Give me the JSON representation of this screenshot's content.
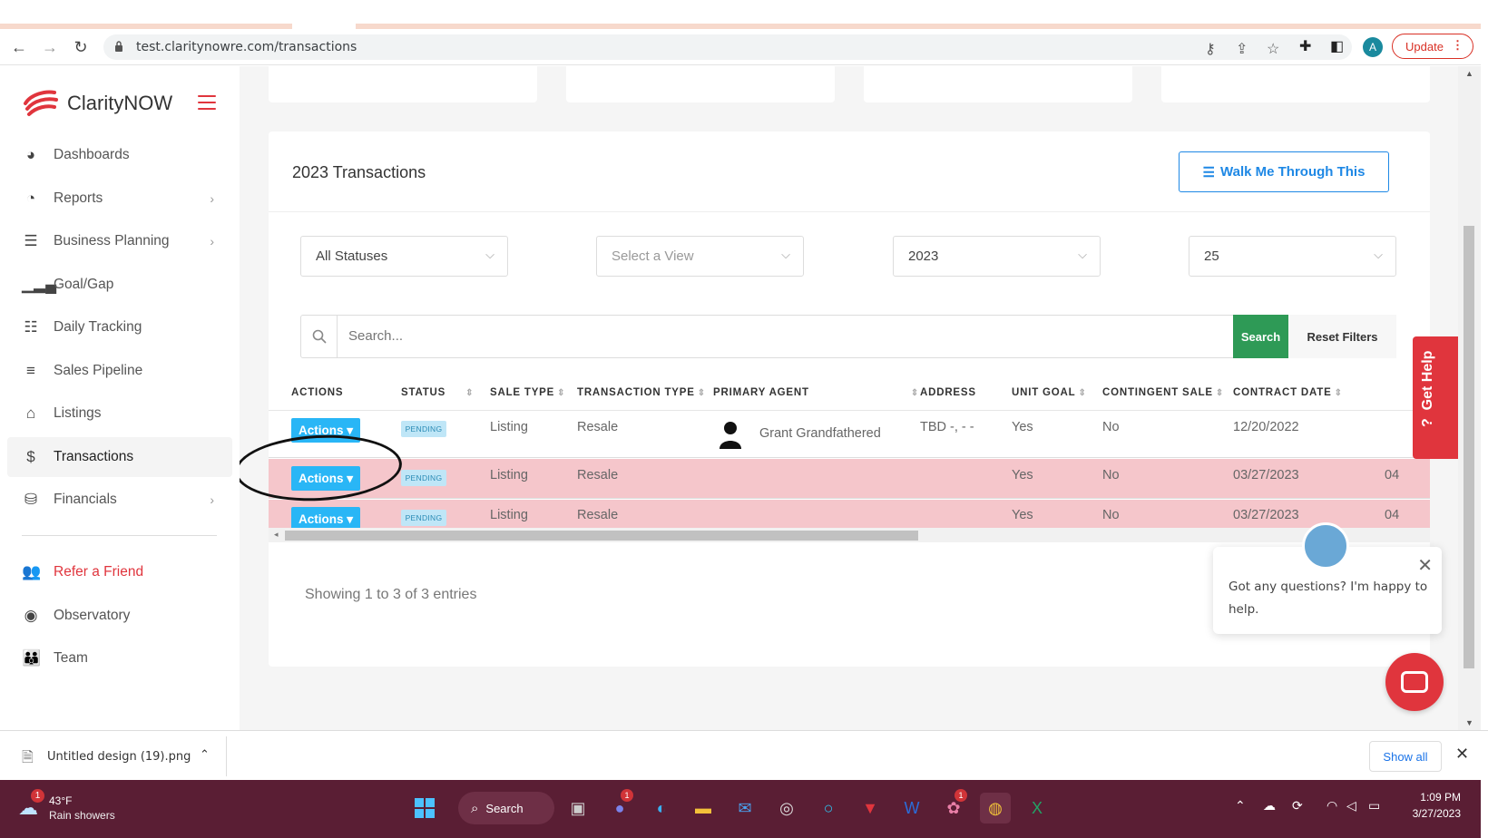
{
  "browser": {
    "url": "test.claritynowre.com/transactions",
    "update_label": "Update",
    "profile_initial": "A"
  },
  "sidebar": {
    "brand": "ClarityNOW",
    "items": [
      {
        "label": "Dashboards",
        "icon": "palette-icon",
        "chevron": false
      },
      {
        "label": "Reports",
        "icon": "pie-chart-icon",
        "chevron": true
      },
      {
        "label": "Business Planning",
        "icon": "checklist-icon",
        "chevron": true
      },
      {
        "label": "Goal/Gap",
        "icon": "signal-bars-icon",
        "chevron": false
      },
      {
        "label": "Daily Tracking",
        "icon": "list-icon",
        "chevron": false
      },
      {
        "label": "Sales Pipeline",
        "icon": "menu-lines-icon",
        "chevron": false
      },
      {
        "label": "Listings",
        "icon": "home-icon",
        "chevron": false
      },
      {
        "label": "Transactions",
        "icon": "dollar-icon",
        "chevron": false,
        "active": true
      },
      {
        "label": "Financials",
        "icon": "coins-icon",
        "chevron": true
      }
    ],
    "secondary": [
      {
        "label": "Refer a Friend",
        "icon": "users-icon"
      },
      {
        "label": "Observatory",
        "icon": "eye-icon"
      },
      {
        "label": "Team",
        "icon": "team-icon"
      }
    ]
  },
  "panel": {
    "title": "2023 Transactions",
    "walk_label": "Walk Me Through This",
    "filters": {
      "status": "All Statuses",
      "view_placeholder": "Select a View",
      "year": "2023",
      "per_page": "25"
    },
    "search_placeholder": "Search...",
    "search_label": "Search",
    "reset_label": "Reset Filters",
    "columns": [
      "ACTIONS",
      "STATUS",
      "SALE TYPE",
      "TRANSACTION TYPE",
      "PRIMARY AGENT",
      "ADDRESS",
      "UNIT GOAL",
      "CONTINGENT SALE",
      "CONTRACT DATE"
    ],
    "rows": [
      {
        "action": "Actions",
        "status": "PENDING",
        "sale_type": "Listing",
        "transaction_type": "Resale",
        "agent": "Grant Grandfathered",
        "address": "TBD -, - -",
        "unit_goal": "Yes",
        "contingent": "No",
        "contract_date": "12/20/2022",
        "extra": ""
      },
      {
        "action": "Actions",
        "status": "PENDING",
        "sale_type": "Listing",
        "transaction_type": "Resale",
        "agent": "",
        "address": "",
        "unit_goal": "Yes",
        "contingent": "No",
        "contract_date": "03/27/2023",
        "extra": "04"
      },
      {
        "action": "Actions",
        "status": "PENDING",
        "sale_type": "Listing",
        "transaction_type": "Resale",
        "agent": "",
        "address": "",
        "unit_goal": "Yes",
        "contingent": "No",
        "contract_date": "03/27/2023",
        "extra": "04"
      }
    ],
    "showing": "Showing 1 to 3 of 3 entries"
  },
  "help": {
    "get_help": "Get Help",
    "chat_message": "Got any questions? I'm happy to help."
  },
  "downloads": {
    "file": "Untitled design (19).png",
    "show_all": "Show all"
  },
  "taskbar": {
    "temp": "43°F",
    "weather": "Rain showers",
    "search_label": "Search",
    "time": "1:09 PM",
    "date": "3/27/2023"
  },
  "colors": {
    "accent_red": "#e0353d",
    "accent_blue": "#1e88e5",
    "search_green": "#2e9a56",
    "row_highlight": "#f5c6cb",
    "taskbar": "#5a1e34"
  }
}
